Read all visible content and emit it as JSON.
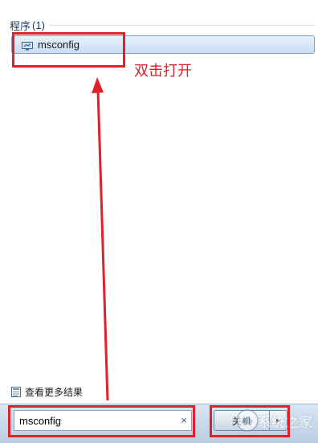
{
  "results": {
    "section_title": "程序",
    "section_count": "(1)",
    "items": [
      {
        "label": "msconfig",
        "icon": "system-config-icon"
      }
    ]
  },
  "annotation": {
    "instruction": "双击打开",
    "color": "#e0202a"
  },
  "footer": {
    "see_more_label": "查看更多结果",
    "see_more_icon": "search-results-icon"
  },
  "search": {
    "value": "msconfig",
    "clear_icon": "×"
  },
  "shutdown": {
    "label": "关机",
    "arrow": "▸"
  },
  "watermark": {
    "text": "系统之家"
  }
}
